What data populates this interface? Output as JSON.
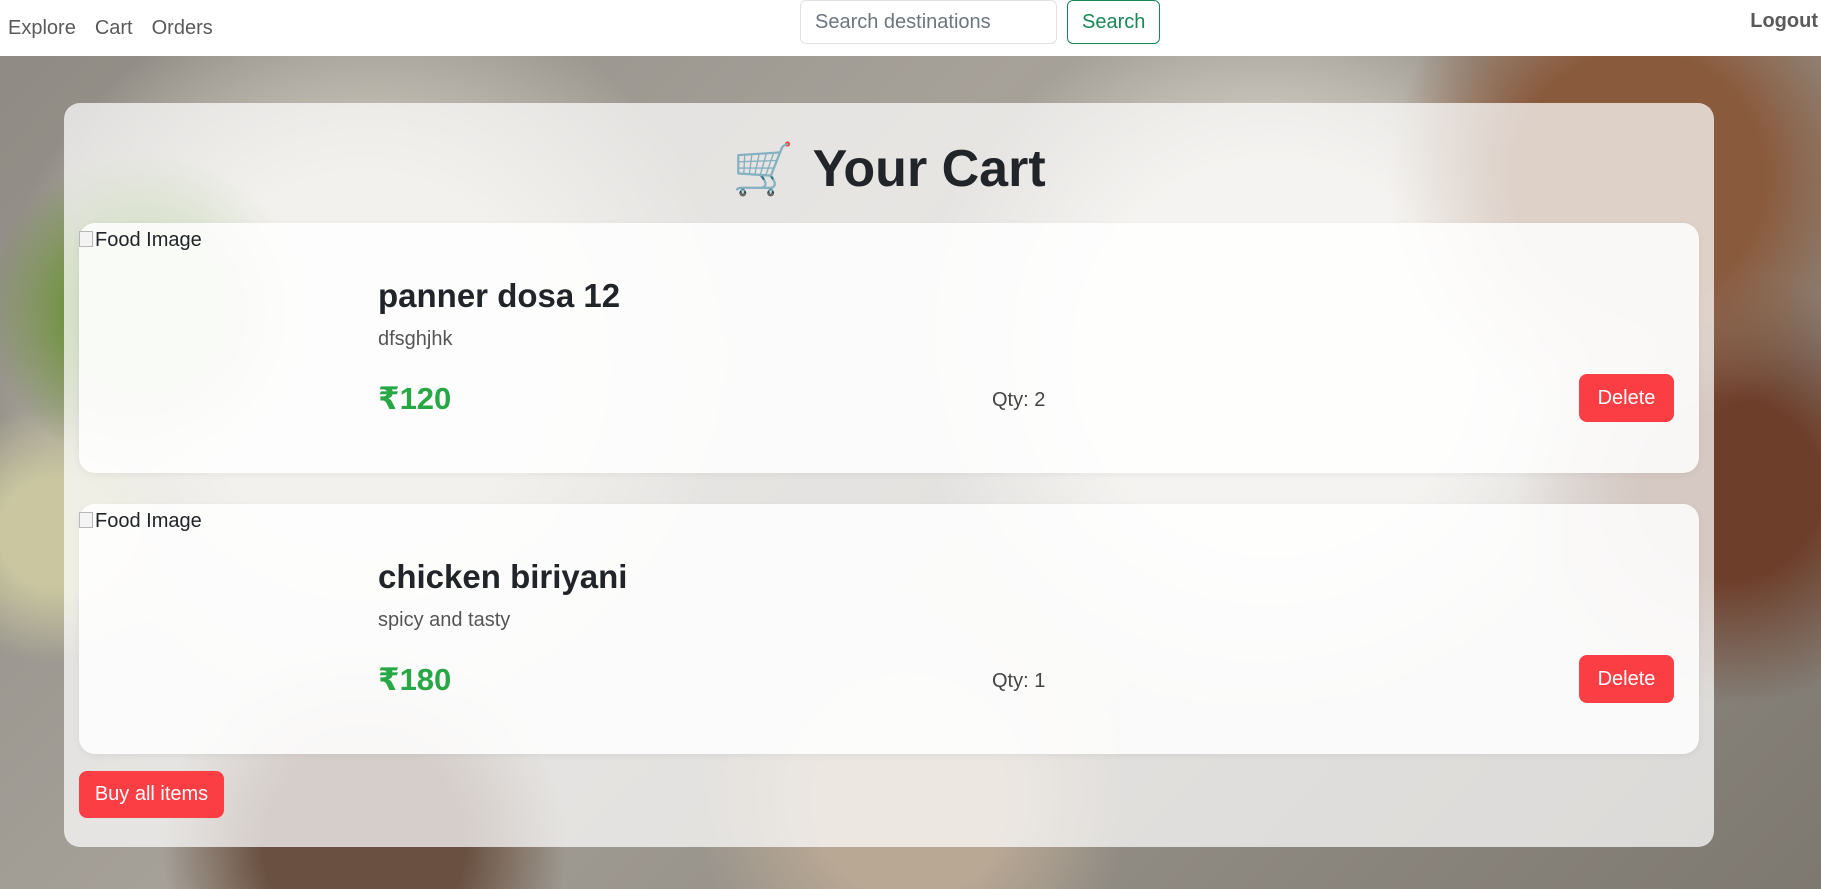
{
  "nav": {
    "links": [
      "Explore",
      "Cart",
      "Orders"
    ],
    "search_placeholder": "Search destinations",
    "search_button": "Search",
    "logout": "Logout"
  },
  "cart": {
    "icon": "shopping-cart-icon",
    "icon_glyph": "🛒",
    "title": "Your Cart",
    "items": [
      {
        "image_alt": "Food Image",
        "name": "panner dosa 12",
        "description": "dfsghjhk",
        "price": "₹120",
        "quantity": "Qty: 2",
        "delete_label": "Delete"
      },
      {
        "image_alt": "Food Image",
        "name": "chicken biriyani",
        "description": "spicy and tasty",
        "price": "₹180",
        "quantity": "Qty: 1",
        "delete_label": "Delete"
      }
    ],
    "buy_all_label": "Buy all items"
  },
  "colors": {
    "accent_red": "#fa3e43",
    "price_green": "#28a745",
    "search_green": "#198754"
  }
}
